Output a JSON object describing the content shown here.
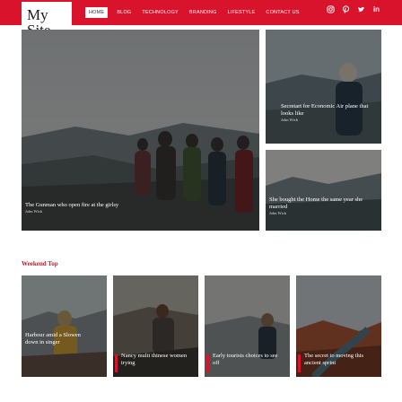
{
  "site": {
    "logo_line1": "My",
    "logo_line2": "Site"
  },
  "nav": {
    "items": [
      {
        "label": "HOME",
        "active": true
      },
      {
        "label": "BLOG",
        "active": false
      },
      {
        "label": "TECHNOLOGY",
        "active": false
      },
      {
        "label": "BRANDING",
        "active": false
      },
      {
        "label": "LIFESTYLE",
        "active": false
      },
      {
        "label": "CONTACT US",
        "active": false
      }
    ]
  },
  "social": [
    {
      "icon": "instagram-icon",
      "glyph": "◎"
    },
    {
      "icon": "pinterest-icon",
      "glyph": "℗"
    },
    {
      "icon": "twitter-icon",
      "glyph": "🐦"
    },
    {
      "icon": "linkedin-icon",
      "glyph": "in"
    }
  ],
  "hero": {
    "main": {
      "title": "The Gunman who open fire at the girlsy",
      "author": "John Wick"
    },
    "side1": {
      "title": "Secretart for Economic Air plane that looks like",
      "author": "John Wick"
    },
    "side2": {
      "title": "She bought the Home the same year she married",
      "author": "John Wick"
    }
  },
  "weekend": {
    "heading": "Weekend Top",
    "cards": [
      {
        "title": "Harbour amid a Slowen down in singer",
        "color": "#ffffff"
      },
      {
        "title": "Nancy multi thinese women trying",
        "color": "#d8132b"
      },
      {
        "title": "Early tourists choices to see off",
        "color": "#d8132b"
      },
      {
        "title": "The secret to moving this ancient sprint",
        "color": "#d8132b"
      }
    ]
  },
  "colors": {
    "accent": "#d8132b",
    "heading": "#c31b2c"
  }
}
